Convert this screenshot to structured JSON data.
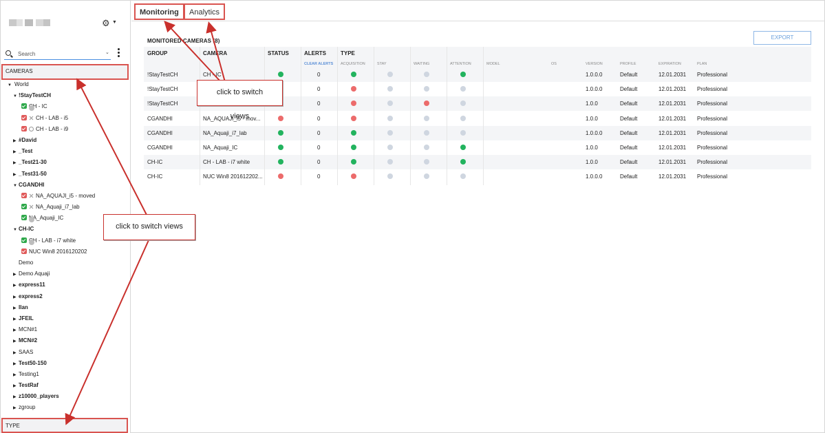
{
  "sidebar": {
    "search_placeholder": "Search",
    "cameras_header": "CAMERAS",
    "type_footer": "TYPE",
    "tree": [
      {
        "label": "World",
        "level": 0,
        "toggle": "down",
        "bold": false
      },
      {
        "label": "!StayTestCH",
        "level": 1,
        "toggle": "down",
        "bold": true
      },
      {
        "label": "CH - IC",
        "level": 2,
        "check": "green",
        "icon": "dot"
      },
      {
        "label": "CH - LAB - i5",
        "level": 2,
        "check": "red",
        "icon": "cross"
      },
      {
        "label": "CH - LAB - i9",
        "level": 2,
        "check": "red",
        "icon": "bubble"
      },
      {
        "label": "#David",
        "level": 1,
        "toggle": "right",
        "bold": true
      },
      {
        "label": "_Test",
        "level": 1,
        "toggle": "right",
        "bold": true
      },
      {
        "label": "_Test21-30",
        "level": 1,
        "toggle": "right",
        "bold": true
      },
      {
        "label": "_Test31-50",
        "level": 1,
        "toggle": "right",
        "bold": true
      },
      {
        "label": "CGANDHI",
        "level": 1,
        "toggle": "down",
        "bold": true
      },
      {
        "label": "NA_AQUAJI_i5 - moved",
        "level": 2,
        "check": "red",
        "icon": "cross"
      },
      {
        "label": "NA_Aquaji_i7_lab",
        "level": 2,
        "check": "green",
        "icon": "cross"
      },
      {
        "label": "NA_Aquaji_IC",
        "level": 2,
        "check": "green",
        "icon": "dot"
      },
      {
        "label": "CH-IC",
        "level": 1,
        "toggle": "down",
        "bold": true
      },
      {
        "label": "CH - LAB - i7 white",
        "level": 2,
        "check": "green",
        "icon": "dot"
      },
      {
        "label": "NUC Win8 2016120202",
        "level": 2,
        "check": "red",
        "icon": ""
      },
      {
        "label": "Demo",
        "level": 1,
        "toggle": "",
        "bold": false
      },
      {
        "label": "Demo Aquaji",
        "level": 1,
        "toggle": "right",
        "bold": false
      },
      {
        "label": "express11",
        "level": 1,
        "toggle": "right",
        "bold": true
      },
      {
        "label": "express2",
        "level": 1,
        "toggle": "right",
        "bold": true
      },
      {
        "label": "Ilan",
        "level": 1,
        "toggle": "right",
        "bold": true
      },
      {
        "label": "JFEIL",
        "level": 1,
        "toggle": "right",
        "bold": true
      },
      {
        "label": "MCN#1",
        "level": 1,
        "toggle": "right",
        "bold": false
      },
      {
        "label": "MCN#2",
        "level": 1,
        "toggle": "right",
        "bold": true
      },
      {
        "label": "SAAS",
        "level": 1,
        "toggle": "right",
        "bold": false
      },
      {
        "label": "Test50-150",
        "level": 1,
        "toggle": "right",
        "bold": true
      },
      {
        "label": "Testing1",
        "level": 1,
        "toggle": "right",
        "bold": false
      },
      {
        "label": "TestRaf",
        "level": 1,
        "toggle": "right",
        "bold": true
      },
      {
        "label": "z10000_players",
        "level": 1,
        "toggle": "right",
        "bold": true
      },
      {
        "label": "zgroup",
        "level": 1,
        "toggle": "right",
        "bold": false
      }
    ]
  },
  "tabs": {
    "monitoring": "Monitoring",
    "analytics": "Analytics"
  },
  "main": {
    "title": "MONITORED CAMERAS (8)",
    "export_label": "EXPORT",
    "headers": {
      "group": "GROUP",
      "camera": "CAMERA",
      "status": "STATUS",
      "alerts": "ALERTS",
      "type": "TYPE"
    },
    "subheaders": {
      "clear_alerts": "CLEAR ALERTS",
      "acquisition": "ACQUISITION",
      "stay": "STAY",
      "waiting": "WAITING",
      "attention": "ATTENTION",
      "model": "MODEL",
      "os": "OS",
      "version": "VERSION",
      "profile": "PROFILE",
      "expiration": "EXPIRATION",
      "plan": "PLAN"
    },
    "rows": [
      {
        "group": "!StayTestCH",
        "camera": "CH - IC",
        "status": "green",
        "alerts": "0",
        "acquisition": "green",
        "stay": "grey",
        "waiting": "grey",
        "attention": "green",
        "version": "1.0.0.0",
        "profile": "Default",
        "expiration": "12.01.2031",
        "plan": "Professional"
      },
      {
        "group": "!StayTestCH",
        "camera": "",
        "status": "",
        "alerts": "0",
        "acquisition": "red",
        "stay": "grey",
        "waiting": "grey",
        "attention": "grey",
        "version": "1.0.0.0",
        "profile": "Default",
        "expiration": "12.01.2031",
        "plan": "Professional"
      },
      {
        "group": "!StayTestCH",
        "camera": "",
        "status": "",
        "alerts": "0",
        "acquisition": "red",
        "stay": "grey",
        "waiting": "red",
        "attention": "grey",
        "version": "1.0.0",
        "profile": "Default",
        "expiration": "12.01.2031",
        "plan": "Professional"
      },
      {
        "group": "CGANDHI",
        "camera": "NA_AQUAJI_i5 - mov...",
        "status": "red",
        "alerts": "0",
        "acquisition": "red",
        "stay": "grey",
        "waiting": "grey",
        "attention": "grey",
        "version": "1.0.0",
        "profile": "Default",
        "expiration": "12.01.2031",
        "plan": "Professional"
      },
      {
        "group": "CGANDHI",
        "camera": "NA_Aquaji_i7_lab",
        "status": "green",
        "alerts": "0",
        "acquisition": "green",
        "stay": "grey",
        "waiting": "grey",
        "attention": "grey",
        "version": "1.0.0.0",
        "profile": "Default",
        "expiration": "12.01.2031",
        "plan": "Professional"
      },
      {
        "group": "CGANDHI",
        "camera": "NA_Aquaji_IC",
        "status": "green",
        "alerts": "0",
        "acquisition": "green",
        "stay": "grey",
        "waiting": "grey",
        "attention": "green",
        "version": "1.0.0",
        "profile": "Default",
        "expiration": "12.01.2031",
        "plan": "Professional"
      },
      {
        "group": "CH-IC",
        "camera": "CH - LAB - i7 white",
        "status": "green",
        "alerts": "0",
        "acquisition": "green",
        "stay": "grey",
        "waiting": "grey",
        "attention": "green",
        "version": "1.0.0",
        "profile": "Default",
        "expiration": "12.01.2031",
        "plan": "Professional"
      },
      {
        "group": "CH-IC",
        "camera": "NUC Win8 201612202...",
        "status": "red",
        "alerts": "0",
        "acquisition": "red",
        "stay": "grey",
        "waiting": "grey",
        "attention": "grey",
        "version": "1.0.0.0",
        "profile": "Default",
        "expiration": "12.01.2031",
        "plan": "Professional"
      }
    ]
  },
  "callouts": {
    "top": "click to switch views",
    "middle": "click to switch views"
  },
  "colors": {
    "accent_red": "#d9534f",
    "status_green": "#22b35e",
    "status_red": "#ec6b6b",
    "status_grey": "#cfd6e0",
    "link_blue": "#5b8fd6"
  }
}
